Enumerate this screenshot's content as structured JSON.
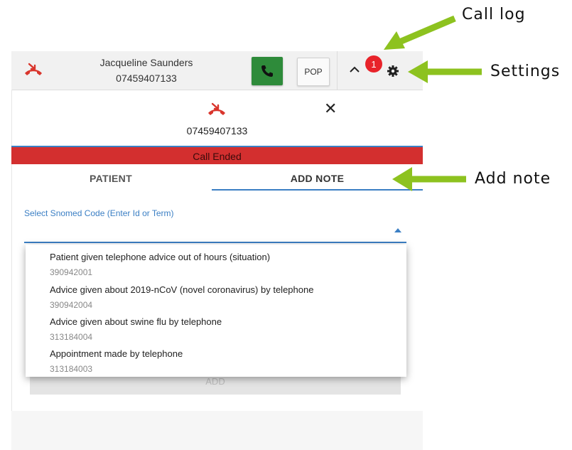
{
  "topbar": {
    "caller_name": "Jacqueline Saunders",
    "caller_number": "07459407133",
    "pop_label": "POP",
    "badge_count": "1"
  },
  "panel": {
    "number": "07459407133",
    "status": "Call Ended",
    "tabs": [
      "PATIENT",
      "ADD NOTE"
    ],
    "field_label": "Select Snomed Code (Enter Id or Term)",
    "options": [
      {
        "term": "Patient given telephone advice out of hours (situation)",
        "code": "390942001"
      },
      {
        "term": "Advice given about 2019-nCoV (novel coronavirus) by telephone",
        "code": "390942004"
      },
      {
        "term": "Advice given about swine flu by telephone",
        "code": "313184004"
      },
      {
        "term": "Appointment made by telephone",
        "code": "313184003"
      }
    ],
    "add_label": "ADD"
  },
  "annotations": {
    "call_log": "Call log",
    "settings": "Settings",
    "add_note": "Add note"
  },
  "colors": {
    "accent": "#3b7fc4",
    "call_green": "#2e8b3a",
    "ended_red": "#d32f2f",
    "badge_red": "#e8232a",
    "arrow_green": "#8dc21f"
  }
}
